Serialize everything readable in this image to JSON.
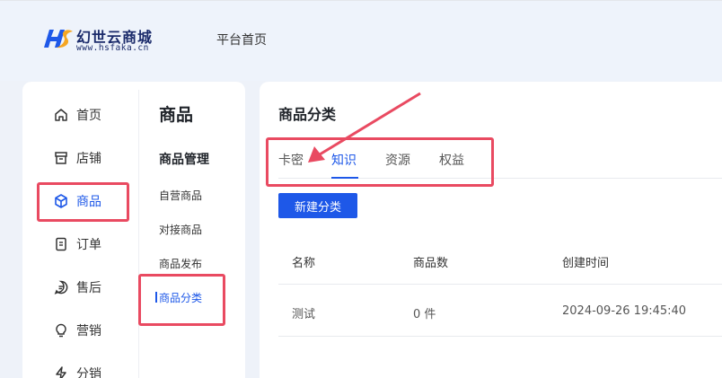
{
  "header": {
    "logo_title": "幻世云商城",
    "logo_url": "www.hsfaka.cn",
    "nav_home": "平台首页"
  },
  "sidebar": {
    "items": [
      {
        "label": "首页",
        "icon": "home-icon"
      },
      {
        "label": "店铺",
        "icon": "store-icon"
      },
      {
        "label": "商品",
        "icon": "cube-icon",
        "active": true
      },
      {
        "label": "订单",
        "icon": "order-icon"
      },
      {
        "label": "售后",
        "icon": "after-sales-icon"
      },
      {
        "label": "营销",
        "icon": "bulb-icon"
      },
      {
        "label": "分销",
        "icon": "lightning-icon"
      }
    ],
    "section_title": "商品",
    "group_title": "商品管理",
    "sub_items": [
      {
        "label": "自营商品"
      },
      {
        "label": "对接商品"
      },
      {
        "label": "商品发布"
      },
      {
        "label": "商品分类",
        "active": true
      }
    ]
  },
  "main": {
    "title": "商品分类",
    "tabs": [
      {
        "label": "卡密"
      },
      {
        "label": "知识",
        "active": true
      },
      {
        "label": "资源"
      },
      {
        "label": "权益"
      }
    ],
    "new_button": "新建分类",
    "table": {
      "headers": [
        "名称",
        "商品数",
        "创建时间"
      ],
      "rows": [
        [
          "测试",
          "0 件",
          "2024-09-26 19:45:40"
        ]
      ]
    }
  },
  "colors": {
    "accent": "#1e58e8",
    "highlight": "#e94a61",
    "background": "#eef2f9"
  }
}
